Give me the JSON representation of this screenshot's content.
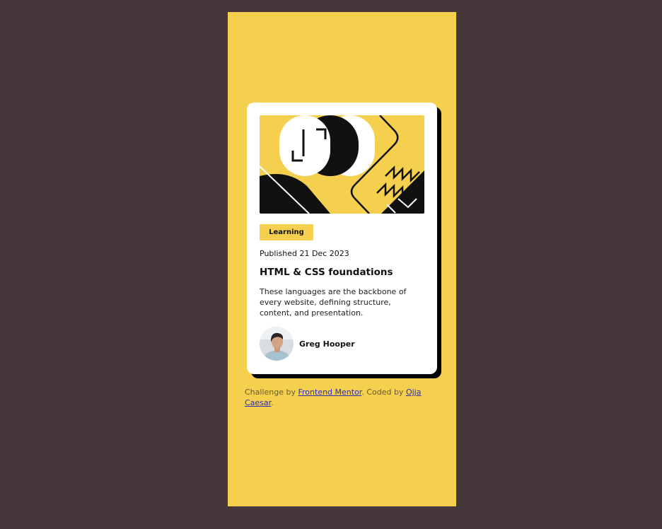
{
  "card": {
    "tag": "Learning",
    "published": "Published 21 Dec 2023",
    "title": "HTML & CSS foundations",
    "description": "These languages are the backbone of every website, defining structure, content, and presentation.",
    "author": "Greg Hooper"
  },
  "attribution": {
    "prefix": "Challenge by ",
    "link1": "Frontend Mentor",
    "middle": ". Coded by ",
    "link2": "Ojja Caesar",
    "suffix": "."
  },
  "colors": {
    "background": "#45373a",
    "yellow": "#f4d04e",
    "card": "#ffffff",
    "shadow": "#000000"
  }
}
